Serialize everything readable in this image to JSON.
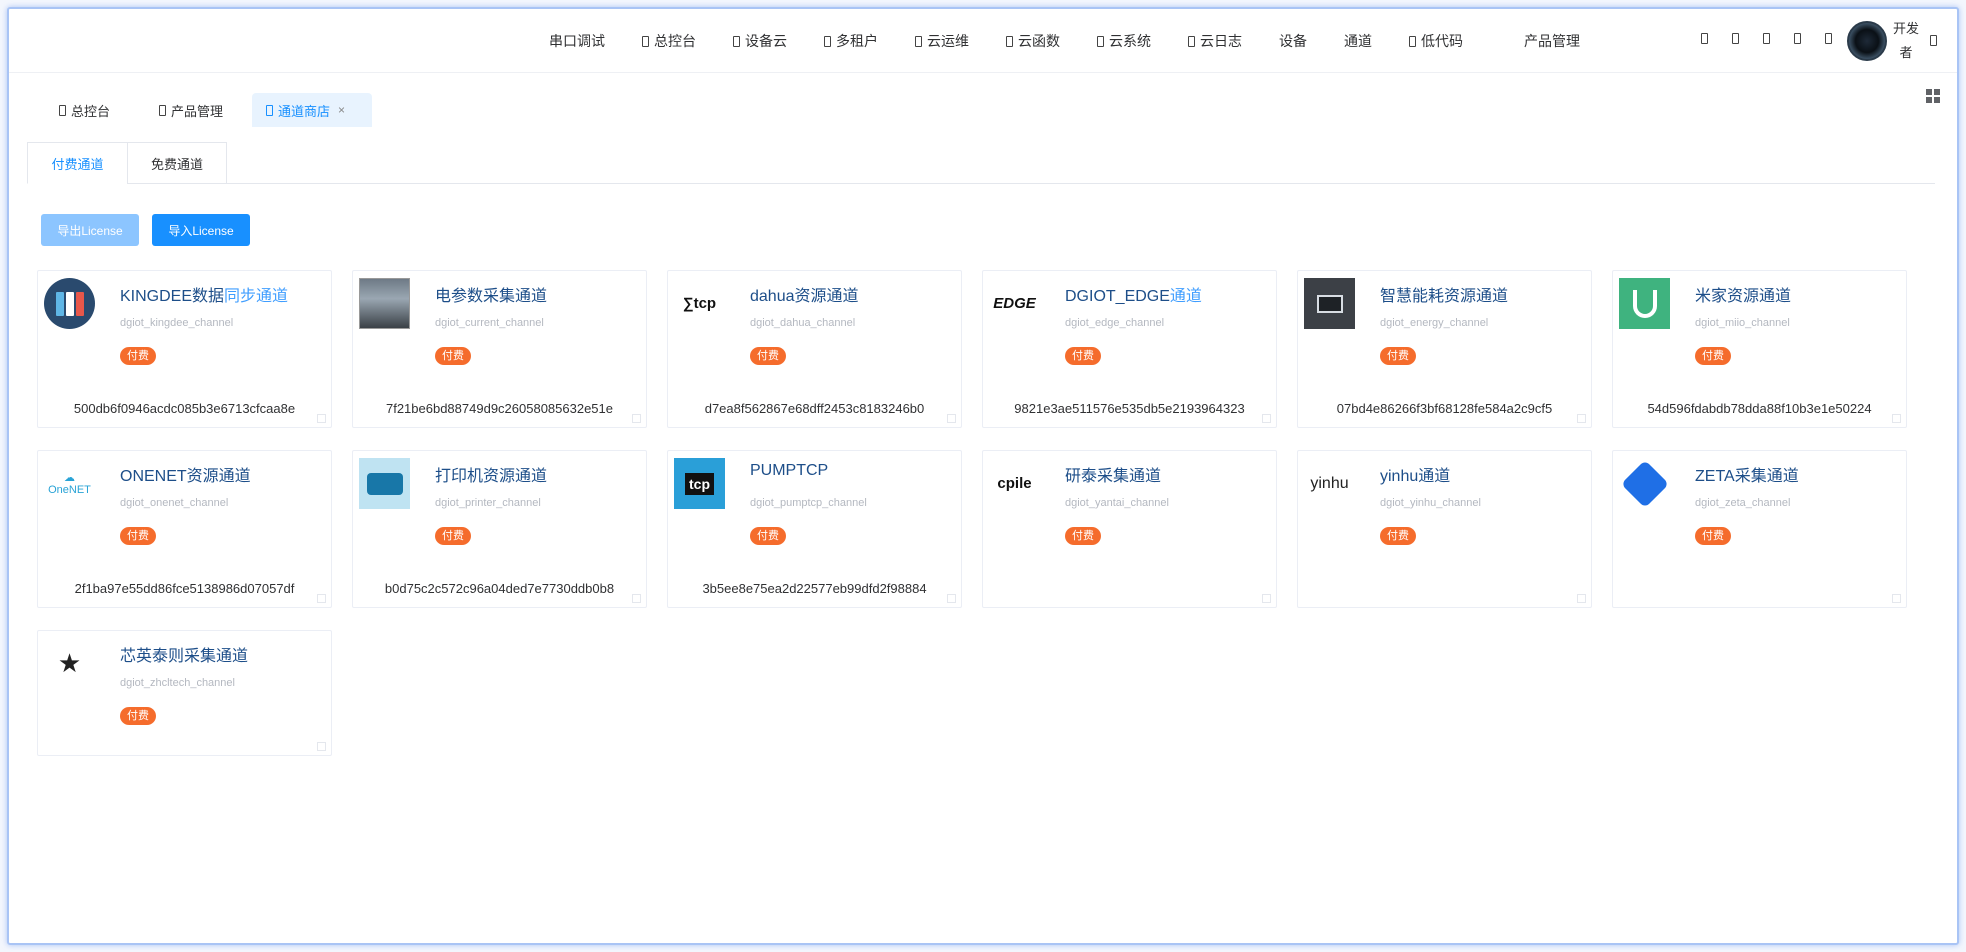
{
  "nav": {
    "items": [
      "串口调试",
      "总控台",
      "设备云",
      "多租户",
      "云运维",
      "云函数",
      "云系统",
      "云日志",
      "设备",
      "通道",
      "低代码"
    ],
    "product_mgmt": "产品管理",
    "user_name": "开发者"
  },
  "tagsview": {
    "tags": [
      "总控台",
      "产品管理",
      "通道商店"
    ],
    "close": "×"
  },
  "tabs": [
    "付费通道",
    "免费通道"
  ],
  "buttons": {
    "export": "导出License",
    "import": "导入License"
  },
  "badge_label": "付费",
  "cards": [
    {
      "title_a": "KINGDEE数据",
      "title_b": "同步通道",
      "sub": "dgiot_kingdee_channel",
      "hash": "500db6f0946acdc085b3e6713cfcaa8e",
      "logo": "kingdee-logo"
    },
    {
      "title_a": "电参数采集通道",
      "title_b": "",
      "sub": "dgiot_current_channel",
      "hash": "7f21be6bd88749d9c26058085632e51e",
      "logo": "current-logo"
    },
    {
      "title_a": "dahua资源通道",
      "title_b": "",
      "sub": "dgiot_dahua_channel",
      "hash": "d7ea8f562867e68dff2453c8183246b0",
      "logo": "tcp-logo",
      "logo_text": "tcp"
    },
    {
      "title_a": "DGIOT_EDGE",
      "title_b": "通道",
      "sub": "dgiot_edge_channel",
      "hash": "9821e3ae511576e535db5e2193964323",
      "logo": "edge-logo",
      "logo_text": "EDGE"
    },
    {
      "title_a": "智慧能耗资源通道",
      "title_b": "",
      "sub": "dgiot_energy_channel",
      "hash": "07bd4e86266f3bf68128fe584a2c9cf5",
      "logo": "energy-logo"
    },
    {
      "title_a": "米家资源通道",
      "title_b": "",
      "sub": "dgiot_miio_channel",
      "hash": "54d596fdabdb78dda88f10b3e1e50224",
      "logo": "mijia-logo"
    },
    {
      "title_a": "ONENET资源通道",
      "title_b": "",
      "sub": "dgiot_onenet_channel",
      "hash": "2f1ba97e55dd86fce5138986d07057df",
      "logo": "onenet-logo",
      "logo_text": "OneNET"
    },
    {
      "title_a": "打印机资源通道",
      "title_b": "",
      "sub": "dgiot_printer_channel",
      "hash": "b0d75c2c572c96a04ded7e7730ddb0b8",
      "logo": "printer-logo"
    },
    {
      "title_a": "PUMPTCP",
      "title_b": "",
      "sub": "dgiot_pumptcp_channel",
      "hash": "3b5ee8e75ea2d22577eb99dfd2f98884",
      "logo": "pumptcp-logo",
      "logo_text": "tcp"
    },
    {
      "title_a": "研泰采集通道",
      "title_b": "",
      "sub": "dgiot_yantai_channel",
      "hash": "",
      "logo": "cpile-logo",
      "logo_text": "cpile"
    },
    {
      "title_a": "yinhu通道",
      "title_b": "",
      "sub": "dgiot_yinhu_channel",
      "hash": "",
      "logo": "yinhu-logo",
      "logo_text": "yinhu"
    },
    {
      "title_a": "ZETA采集通道",
      "title_b": "",
      "sub": "dgiot_zeta_channel",
      "hash": "",
      "logo": "zeta-logo"
    },
    {
      "title_a": "芯英泰则采集通道",
      "title_b": "",
      "sub": "dgiot_zhcltech_channel",
      "hash": "",
      "logo": "zhcltech-logo"
    }
  ]
}
